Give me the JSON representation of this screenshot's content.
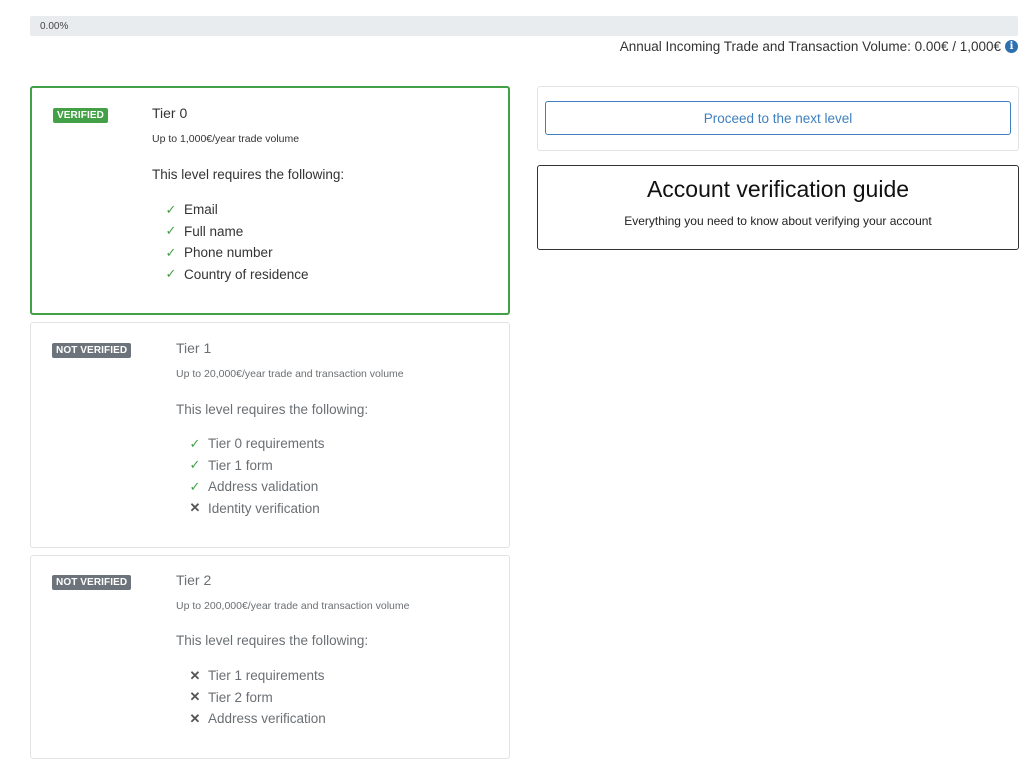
{
  "progress": {
    "label": "0.00%",
    "value_percent": 0,
    "fill_color": "#3f7fbf"
  },
  "volume": {
    "text": "Annual Incoming Trade and Transaction Volume: 0.00€ / 1,000€",
    "icon": "info-icon"
  },
  "tiers": [
    {
      "badge": "VERIFIED",
      "title": "Tier 0",
      "subtitle": "Up to 1,000€/year trade volume",
      "requires_label": "This level requires the following:",
      "requirements": [
        {
          "label": "Email",
          "met": true
        },
        {
          "label": "Full name",
          "met": true
        },
        {
          "label": "Phone number",
          "met": true
        },
        {
          "label": "Country of residence",
          "met": true
        }
      ]
    },
    {
      "badge": "NOT VERIFIED",
      "title": "Tier 1",
      "subtitle": "Up to 20,000€/year trade and transaction volume",
      "requires_label": "This level requires the following:",
      "requirements": [
        {
          "label": "Tier 0 requirements",
          "met": true
        },
        {
          "label": "Tier 1 form",
          "met": true
        },
        {
          "label": "Address validation",
          "met": true
        },
        {
          "label": "Identity verification",
          "met": false
        }
      ]
    },
    {
      "badge": "NOT VERIFIED",
      "title": "Tier 2",
      "subtitle": "Up to 200,000€/year trade and transaction volume",
      "requires_label": "This level requires the following:",
      "requirements": [
        {
          "label": "Tier 1 requirements",
          "met": false
        },
        {
          "label": "Tier 2 form",
          "met": false
        },
        {
          "label": "Address verification",
          "met": false
        }
      ]
    }
  ],
  "next_level": {
    "button_label": "Proceed to the next level"
  },
  "guide": {
    "title": "Account verification guide",
    "subtitle": "Everything you need to know about verifying your account"
  },
  "colors": {
    "verified": "#43a047",
    "not_verified": "#6c737a",
    "accent": "#3f7fbf"
  },
  "icons": {
    "met": "check-icon",
    "unmet": "cross-icon"
  }
}
